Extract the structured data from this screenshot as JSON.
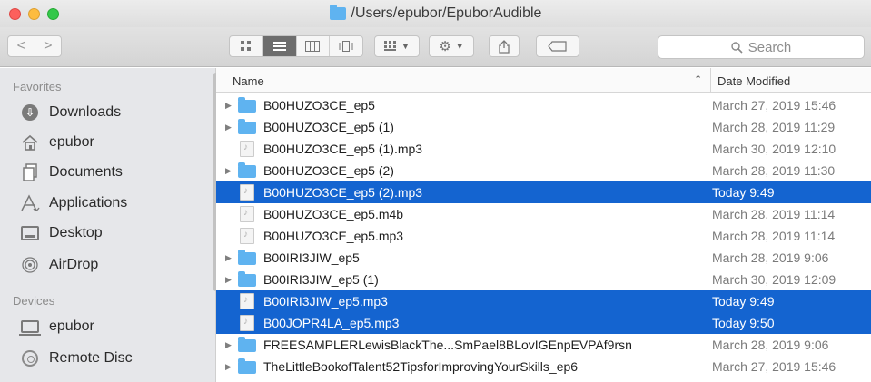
{
  "window": {
    "title": "/Users/epubor/EpuborAudible"
  },
  "toolbar": {
    "back_glyph": "<",
    "forward_glyph": ">",
    "view_icons": [
      "icon-view",
      "list-view",
      "column-view",
      "cover-flow-view"
    ],
    "search_placeholder": "Search"
  },
  "sidebar": {
    "favorites_header": "Favorites",
    "favorites": [
      {
        "label": "Downloads",
        "icon": "downloads-icon"
      },
      {
        "label": "epubor",
        "icon": "home-icon"
      },
      {
        "label": "Documents",
        "icon": "documents-icon"
      },
      {
        "label": "Applications",
        "icon": "applications-icon"
      },
      {
        "label": "Desktop",
        "icon": "desktop-icon"
      },
      {
        "label": "AirDrop",
        "icon": "airdrop-icon"
      }
    ],
    "devices_header": "Devices",
    "devices": [
      {
        "label": "epubor",
        "icon": "laptop-icon"
      },
      {
        "label": "Remote Disc",
        "icon": "disc-icon"
      }
    ]
  },
  "list": {
    "columns": {
      "name": "Name",
      "date": "Date Modified"
    },
    "rows": [
      {
        "name": "B00HUZO3CE_ep5",
        "date": "March 27, 2019 15:46",
        "kind": "folder",
        "selected": false
      },
      {
        "name": "B00HUZO3CE_ep5 (1)",
        "date": "March 28, 2019 11:29",
        "kind": "folder",
        "selected": false
      },
      {
        "name": "B00HUZO3CE_ep5 (1).mp3",
        "date": "March 30, 2019 12:10",
        "kind": "file",
        "selected": false
      },
      {
        "name": "B00HUZO3CE_ep5 (2)",
        "date": "March 28, 2019 11:30",
        "kind": "folder",
        "selected": false
      },
      {
        "name": "B00HUZO3CE_ep5 (2).mp3",
        "date": "Today 9:49",
        "kind": "file",
        "selected": true
      },
      {
        "name": "B00HUZO3CE_ep5.m4b",
        "date": "March 28, 2019 11:14",
        "kind": "file",
        "selected": false
      },
      {
        "name": "B00HUZO3CE_ep5.mp3",
        "date": "March 28, 2019 11:14",
        "kind": "file",
        "selected": false
      },
      {
        "name": "B00IRI3JIW_ep5",
        "date": "March 28, 2019 9:06",
        "kind": "folder",
        "selected": false
      },
      {
        "name": "B00IRI3JIW_ep5 (1)",
        "date": "March 30, 2019 12:09",
        "kind": "folder",
        "selected": false
      },
      {
        "name": "B00IRI3JIW_ep5.mp3",
        "date": "Today 9:49",
        "kind": "file",
        "selected": true
      },
      {
        "name": "B00JOPR4LA_ep5.mp3",
        "date": "Today 9:50",
        "kind": "file",
        "selected": true
      },
      {
        "name": "FREESAMPLERLewisBlackThe...SmPael8BLovIGEnpEVPAf9rsn",
        "date": "March 28, 2019 9:06",
        "kind": "folder",
        "selected": false
      },
      {
        "name": "TheLittleBookofTalent52TipsforImprovingYourSkills_ep6",
        "date": "March 27, 2019 15:46",
        "kind": "folder",
        "selected": false
      }
    ]
  }
}
